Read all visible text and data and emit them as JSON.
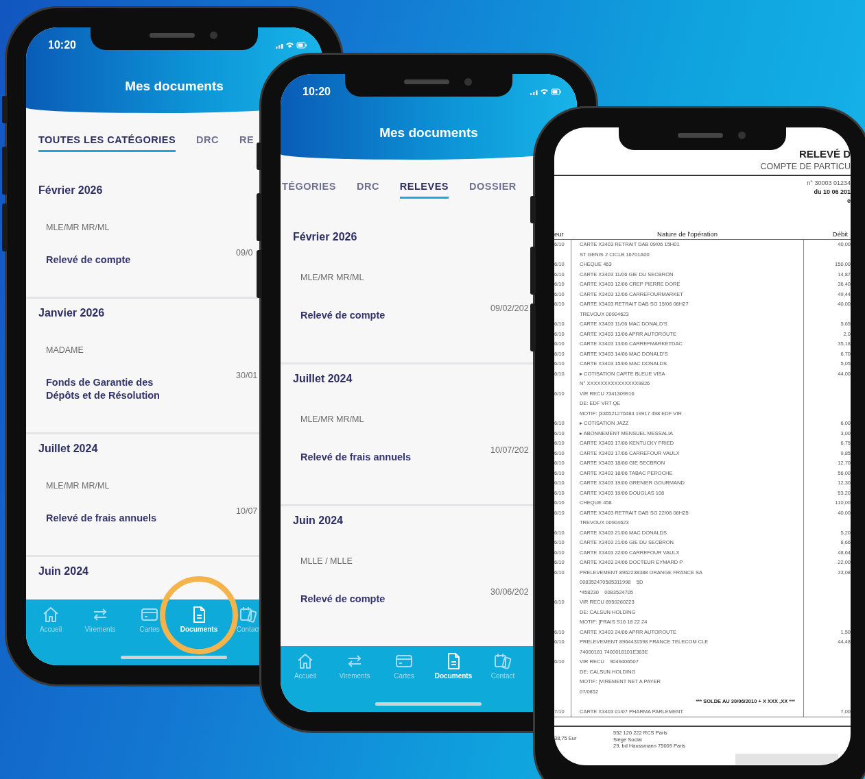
{
  "phones": [
    {
      "kind": "app",
      "time": "10:20",
      "title": "Mes documents",
      "tabs": [
        {
          "label": "TOUTES LES CATÉGORIES",
          "selected": true
        },
        {
          "label": "DRC",
          "selected": false
        },
        {
          "label": "RE",
          "selected": false
        }
      ],
      "sections": [
        {
          "heading": "Février 2026",
          "items": [
            {
              "recipient": "MLE/MR MR/ML",
              "title": "Relevé de compte",
              "date": "09/0"
            }
          ]
        },
        {
          "heading": "Janvier 2026",
          "items": [
            {
              "recipient": "MADAME",
              "title": "Fonds de Garantie des Dépôts et de Résolution",
              "date": "30/01"
            }
          ]
        },
        {
          "heading": "Juillet 2024",
          "items": [
            {
              "recipient": "MLE/MR MR/ML",
              "title": "Relevé de frais annuels",
              "date": "10/07"
            }
          ]
        },
        {
          "heading": "Juin 2024"
        }
      ],
      "nav": [
        {
          "label": "Accueil",
          "selected": false,
          "circled": false
        },
        {
          "label": "Virements",
          "selected": false,
          "circled": false
        },
        {
          "label": "Cartes",
          "selected": false,
          "circled": false
        },
        {
          "label": "Documents",
          "selected": true,
          "circled": true
        },
        {
          "label": "Contact",
          "selected": false,
          "circled": false
        }
      ]
    },
    {
      "kind": "app",
      "time": "10:20",
      "title": "Mes documents",
      "tabs": [
        {
          "label": "TÉGORIES",
          "selected": false
        },
        {
          "label": "DRC",
          "selected": false
        },
        {
          "label": "RELEVES",
          "selected": true
        },
        {
          "label": "DOSSIER",
          "selected": false
        }
      ],
      "sections": [
        {
          "heading": "Février 2026",
          "items": [
            {
              "recipient": "MLE/MR MR/ML",
              "title": "Relevé de compte",
              "date": "09/02/202"
            }
          ]
        },
        {
          "heading": "Juillet 2024",
          "items": [
            {
              "recipient": "MLE/MR MR/ML",
              "title": "Relevé de frais annuels",
              "date": "10/07/202"
            }
          ]
        },
        {
          "heading": "Juin 2024",
          "items": [
            {
              "recipient": "MLLE / MLLE",
              "title": "Relevé de compte",
              "date": "30/06/202"
            }
          ]
        }
      ],
      "nav": [
        {
          "label": "Accueil",
          "selected": false,
          "circled": false
        },
        {
          "label": "Virements",
          "selected": false,
          "circled": false
        },
        {
          "label": "Cartes",
          "selected": false,
          "circled": false
        },
        {
          "label": "Documents",
          "selected": true,
          "circled": false
        },
        {
          "label": "Contact",
          "selected": false,
          "circled": false
        }
      ]
    },
    {
      "kind": "statement",
      "title": "RELEVÉ D",
      "subtitle": "COMPTE DE PARTICU",
      "account": "n° 30003 01234",
      "period": "du 10 06 201",
      "period_end": "e",
      "columns": [
        "eur",
        "Nature de l'opération",
        "Débit"
      ],
      "rows": [
        {
          "kind": "entry",
          "date": "6/10",
          "lines": [
            "CARTE X3403 RETRAIT DAB 09/06 15H01",
            "ST GENIS 2 CICLB 16701A00"
          ],
          "debit": "40,00"
        },
        {
          "kind": "entry",
          "date": "6/10",
          "lines": [
            "CHEQUE 463"
          ],
          "debit": "150,00"
        },
        {
          "kind": "entry",
          "date": "6/10",
          "lines": [
            "CARTE X3403 11/06 GIE DU SECBRON"
          ],
          "debit": "14,87"
        },
        {
          "kind": "entry",
          "date": "6/10",
          "lines": [
            "CARTE X3403 12/06 CREP PIERRE DORE"
          ],
          "debit": "36,40"
        },
        {
          "kind": "entry",
          "date": "6/10",
          "lines": [
            "CARTE X3403 12/06 CARREFOURMARKET"
          ],
          "debit": "49,44"
        },
        {
          "kind": "entry",
          "date": "6/10",
          "lines": [
            "CARTE X3403 RETRAIT DAB SG 15/06 06H27",
            "TREVOUX 00904623"
          ],
          "debit": "40,00"
        },
        {
          "kind": "entry",
          "date": "6/10",
          "lines": [
            "CARTE X3403 11/06 MAC DONALD'S"
          ],
          "debit": "5,65"
        },
        {
          "kind": "entry",
          "date": "6/10",
          "lines": [
            "CARTE X3403 13/06 APRR AUTOROUTE"
          ],
          "debit": "2,0"
        },
        {
          "kind": "entry",
          "date": "6/10",
          "lines": [
            "CARTE X3403 13/06 CARREFMARKETDAC"
          ],
          "debit": "35,18"
        },
        {
          "kind": "entry",
          "date": "6/10",
          "lines": [
            "CARTE X3403 14/06 MAC DONALD'S"
          ],
          "debit": "6,70"
        },
        {
          "kind": "entry",
          "date": "6/10",
          "lines": [
            "CARTE X3403 15/06 MAC DONALDS"
          ],
          "debit": "5,05"
        },
        {
          "kind": "entry",
          "date": "6/10",
          "lines": [
            "▸ COTISATION CARTE BLEUE VISA",
            "N° XXXXXXXXXXXXXXX9826"
          ],
          "debit": "44,00"
        },
        {
          "kind": "entry",
          "date": "6/10",
          "lines": [
            "VIR RECU 7341309916",
            "DE: EDF VRT QE",
            "MOTIF: [336521276484 19917 498 EDF VIR"
          ]
        },
        {
          "kind": "entry",
          "date": "6/10",
          "lines": [
            "▸ COTISATION JAZZ"
          ],
          "debit": "6,00"
        },
        {
          "kind": "entry",
          "date": "6/10",
          "lines": [
            "▸ ABONNEMENT MENSUEL MESSALIA"
          ],
          "debit": "3,00"
        },
        {
          "kind": "entry",
          "date": "6/10",
          "lines": [
            "CARTE X3403 17/06 KENTUCKY FRIED"
          ],
          "debit": "6,75"
        },
        {
          "kind": "entry",
          "date": "6/10",
          "lines": [
            "CARTE X3403 17/06 CARREFOUR VAULX"
          ],
          "debit": "9,85"
        },
        {
          "kind": "entry",
          "date": "6/10",
          "lines": [
            "CARTE X3403 18/06 GIE SECBRON"
          ],
          "debit": "12,70"
        },
        {
          "kind": "entry",
          "date": "6/10",
          "lines": [
            "CARTE X3403 18/06 TABAC PEROCHE"
          ],
          "debit": "56,00"
        },
        {
          "kind": "entry",
          "date": "6/10",
          "lines": [
            "CARTE X3403 19/06 GRENIER GOURMAND"
          ],
          "debit": "12,30"
        },
        {
          "kind": "entry",
          "date": "6/10",
          "lines": [
            "CARTE X3403 19/06 DOUGLAS 108"
          ],
          "debit": "53,20"
        },
        {
          "kind": "entry",
          "date": "6/10",
          "lines": [
            "CHEQUE 458"
          ],
          "debit": "110,00"
        },
        {
          "kind": "entry",
          "date": "6/10",
          "lines": [
            "CARTE X3403 RETRAIT DAB SG 22/06 06H25",
            "TREVOUX 00904623"
          ],
          "debit": "40,00"
        },
        {
          "kind": "entry",
          "date": "6/10",
          "lines": [
            "CARTE X3403 21/06 MAC DONALDS"
          ],
          "debit": "5,20"
        },
        {
          "kind": "entry",
          "date": "6/10",
          "lines": [
            "CARTE X3403 21/06 GIE DU SECBRON"
          ],
          "debit": "8,66"
        },
        {
          "kind": "entry",
          "date": "6/10",
          "lines": [
            "CARTE X3403 22/06 CARREFOUR VAULX"
          ],
          "debit": "48,64"
        },
        {
          "kind": "entry",
          "date": "6/10",
          "lines": [
            "CARTE X3403 24/06 DOCTEUR EYMARD P"
          ],
          "debit": "22,00"
        },
        {
          "kind": "entry",
          "date": "6/10",
          "lines": [
            "PRELEVEMENT 8962238388 ORANGE FRANCE SA",
            "008352470585311998    5D",
            "*458230    0083524705"
          ],
          "debit": "33,08"
        },
        {
          "kind": "entry",
          "date": "6/10",
          "lines": [
            "VIR RECU 8950260223",
            "DE: CALSUN HOLDING",
            "MOTIF: [FRAIS S16 18 22 24"
          ]
        },
        {
          "kind": "entry",
          "date": "6/10",
          "lines": [
            "CARTE X3403 24/06 APRR AUTOROUTE"
          ],
          "debit": "1,50"
        },
        {
          "kind": "entry",
          "date": "6/10",
          "lines": [
            "PRELEVEMENT 8964431598 FRANCE TELECOM CLE",
            "74000181 7400018101E363E"
          ],
          "debit": "44,48"
        },
        {
          "kind": "entry",
          "date": "6/10",
          "lines": [
            "VIR RECU    9049406507",
            "DE: CALSUN HOLDING",
            "MOTIF: [VIREMENT NET A PAYER",
            "07/0852"
          ]
        },
        {
          "kind": "balance",
          "text": "*** SOLDE AU 30/06/2010 + X XXX ,XX ***"
        },
        {
          "kind": "entry",
          "date": "7/10",
          "lines": [
            "CARTE X3403 01/07 PHARMA PARLEMENT"
          ],
          "debit": "7,00"
        }
      ],
      "footer_amount": "38,75 Eur",
      "footer_lines": [
        "552 120 222 RCS Paris",
        "Siège Social",
        "29, bd Haussmann 75009 Paris"
      ]
    }
  ]
}
